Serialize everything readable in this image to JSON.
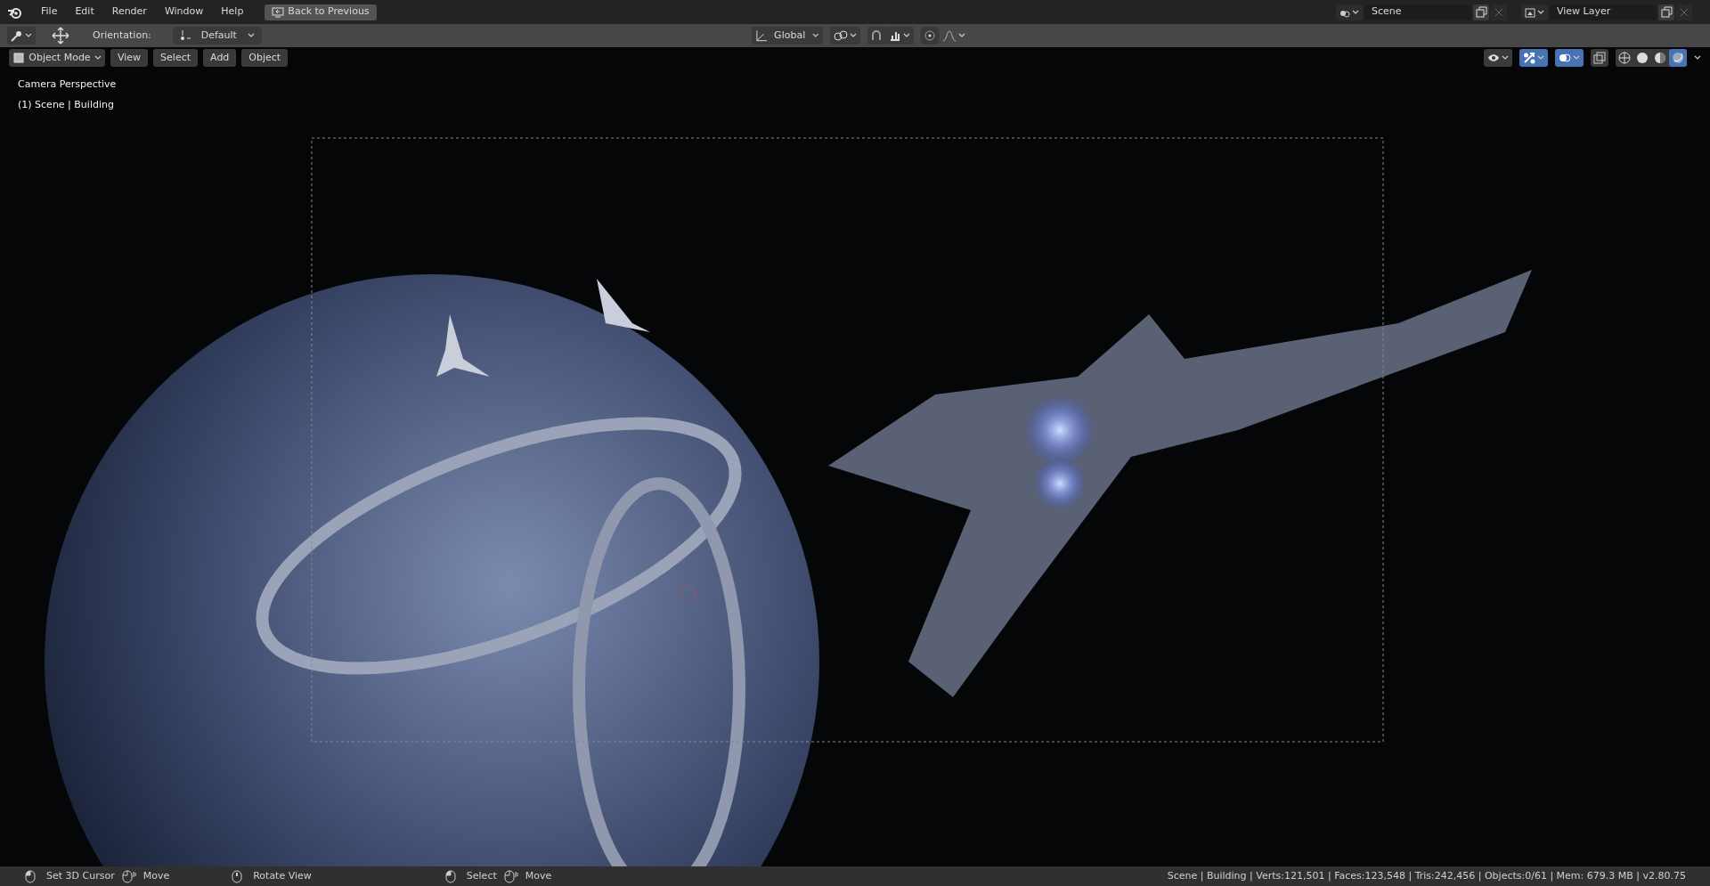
{
  "menu": [
    "File",
    "Edit",
    "Render",
    "Window",
    "Help"
  ],
  "back_button": "Back to Previous",
  "scene": {
    "value": "Scene"
  },
  "view_layer": {
    "value": "View Layer"
  },
  "tool_header": {
    "orientation_label": "Orientation:",
    "orientation_value": "Default",
    "transform_orientation": "Global",
    "snap_on": false,
    "proportional_on": false
  },
  "viewport_header": {
    "mode": "Object Mode",
    "menus": [
      "View",
      "Select",
      "Add",
      "Object"
    ],
    "gizmos_on": true,
    "overlays_on": true,
    "xray_on": false,
    "shading_modes": [
      {
        "kind": "wireframe",
        "selected": false
      },
      {
        "kind": "solid",
        "selected": false
      },
      {
        "kind": "material",
        "selected": false
      },
      {
        "kind": "rendered",
        "selected": true
      }
    ]
  },
  "viewport_info": [
    "Camera Perspective",
    "(1) Scene | Building"
  ],
  "status_bar": {
    "hints": [
      {
        "kind": "left",
        "label": "Set 3D Cursor"
      },
      {
        "kind": "drag",
        "label": "Move"
      },
      {
        "kind": "middle",
        "label": "Rotate View"
      },
      {
        "kind": "left",
        "label": "Select"
      },
      {
        "kind": "drag",
        "label": "Move"
      }
    ],
    "stats": "Scene | Building | Verts:121,501 | Faces:123,548 | Tris:242,456 | Objects:0/61 | Mem: 679.3 MB | v2.80.75"
  }
}
